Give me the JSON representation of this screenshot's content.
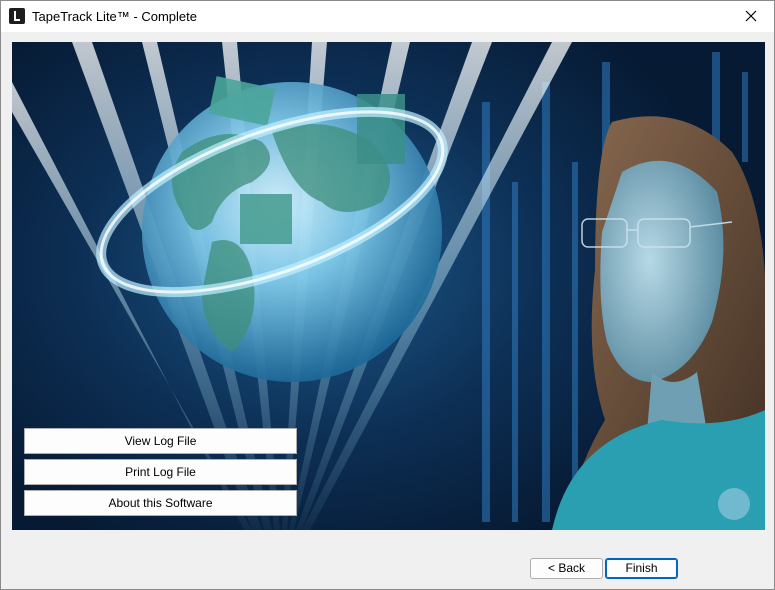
{
  "window": {
    "title": "TapeTrack Lite™ - Complete"
  },
  "icons": {
    "app": "tapetrack-app-icon",
    "close": "close-icon"
  },
  "actions": {
    "view_log": "View Log File",
    "print_log": "Print Log File",
    "about": "About this Software"
  },
  "nav": {
    "back": "< Back",
    "finish": "Finish"
  },
  "colors": {
    "accent": "#0067c0",
    "hero_dark": "#061a33",
    "hero_glow": "#6fd3f5"
  }
}
